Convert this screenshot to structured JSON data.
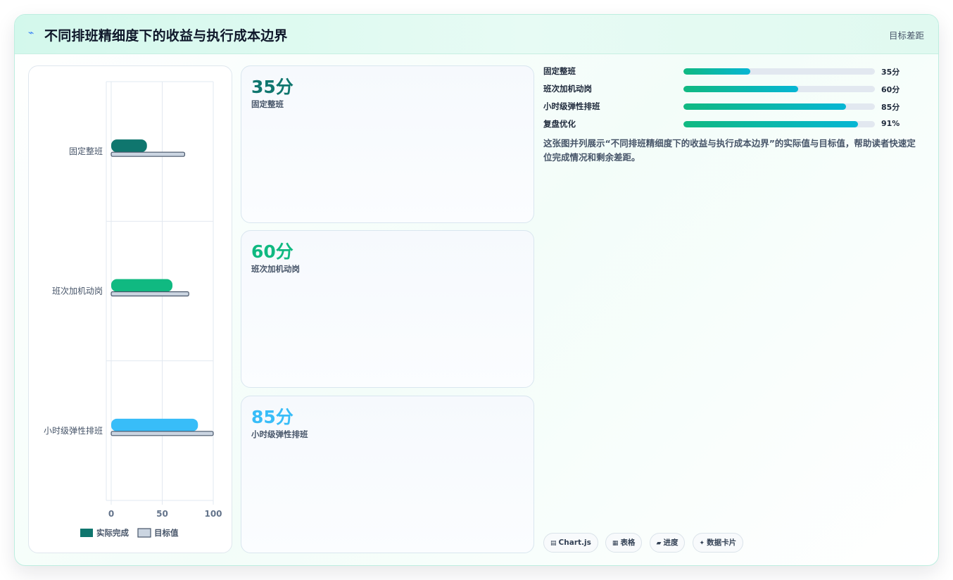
{
  "header": {
    "icon": "lightning-icon",
    "title": "不同排班精细度下的收益与执行成本边界",
    "subtitle": "目标差距"
  },
  "chart_data": {
    "type": "bar",
    "orientation": "horizontal",
    "categories": [
      "固定整班",
      "班次加机动岗",
      "小时级弹性排班"
    ],
    "series": [
      {
        "name": "实际完成",
        "values": [
          35,
          60,
          85
        ],
        "colors": [
          "#0f766e",
          "#10b981",
          "#38bdf8"
        ]
      },
      {
        "name": "目标值",
        "values": [
          72,
          76,
          100
        ],
        "color": "#cbd5e1",
        "border": "#475569"
      }
    ],
    "xlim": [
      0,
      100
    ],
    "xticks": [
      "0",
      "50",
      "100"
    ],
    "grid": true,
    "legend": "bottom"
  },
  "metrics": [
    {
      "value": "35分",
      "label": "固定整班",
      "color": "#0f766e"
    },
    {
      "value": "60分",
      "label": "班次加机动岗",
      "color": "#10b981"
    },
    {
      "value": "85分",
      "label": "小时级弹性排班",
      "color": "#38bdf8"
    }
  ],
  "progress": [
    {
      "label": "固定整班",
      "value": "35分",
      "fraction": 0.35
    },
    {
      "label": "班次加机动岗",
      "value": "60分",
      "fraction": 0.6
    },
    {
      "label": "小时级弹性排班",
      "value": "85分",
      "fraction": 0.85
    },
    {
      "label": "复盘优化",
      "value": "91%",
      "fraction": 0.91
    }
  ],
  "description": "这张图并列展示“不同排班精细度下的收益与执行成本边界”的实际值与目标值，帮助读者快速定位完成情况和剩余差距。",
  "chips": [
    {
      "icon": "chart-icon",
      "glyph": "▤",
      "label": "Chart.js"
    },
    {
      "icon": "table-icon",
      "glyph": "▦",
      "label": "表格"
    },
    {
      "icon": "progress-icon",
      "glyph": "▰",
      "label": "进度"
    },
    {
      "icon": "sparkle-icon",
      "glyph": "✦",
      "label": "数据卡片"
    }
  ]
}
